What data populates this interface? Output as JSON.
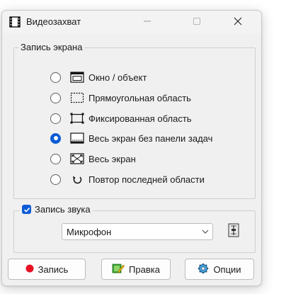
{
  "window": {
    "title": "Видеозахват",
    "icons": {
      "app": "film-icon",
      "minimize": "minimize-icon",
      "maximize": "maximize-icon",
      "close": "close-icon"
    }
  },
  "screen_group": {
    "label": "Запись экрана",
    "selected_index": 3,
    "options": [
      {
        "label": "Окно / объект",
        "icon": "window-object-icon"
      },
      {
        "label": "Прямоугольная область",
        "icon": "rectangle-area-icon"
      },
      {
        "label": "Фиксированная область",
        "icon": "fixed-area-icon"
      },
      {
        "label": "Весь экран без панели задач",
        "icon": "screen-without-taskbar-icon"
      },
      {
        "label": "Весь экран",
        "icon": "full-screen-icon"
      },
      {
        "label": "Повтор последней области",
        "icon": "repeat-area-icon"
      }
    ]
  },
  "sound_group": {
    "label": "Запись звука",
    "checked": true,
    "device": "Микрофон",
    "mixer_icon": "audio-mixer-icon"
  },
  "buttons": {
    "record": "Запись",
    "edit": "Правка",
    "options": "Опции"
  },
  "colors": {
    "accent": "#0b5cd5",
    "record_dot": "#e81123",
    "window_bg": "#f0f0f0"
  }
}
